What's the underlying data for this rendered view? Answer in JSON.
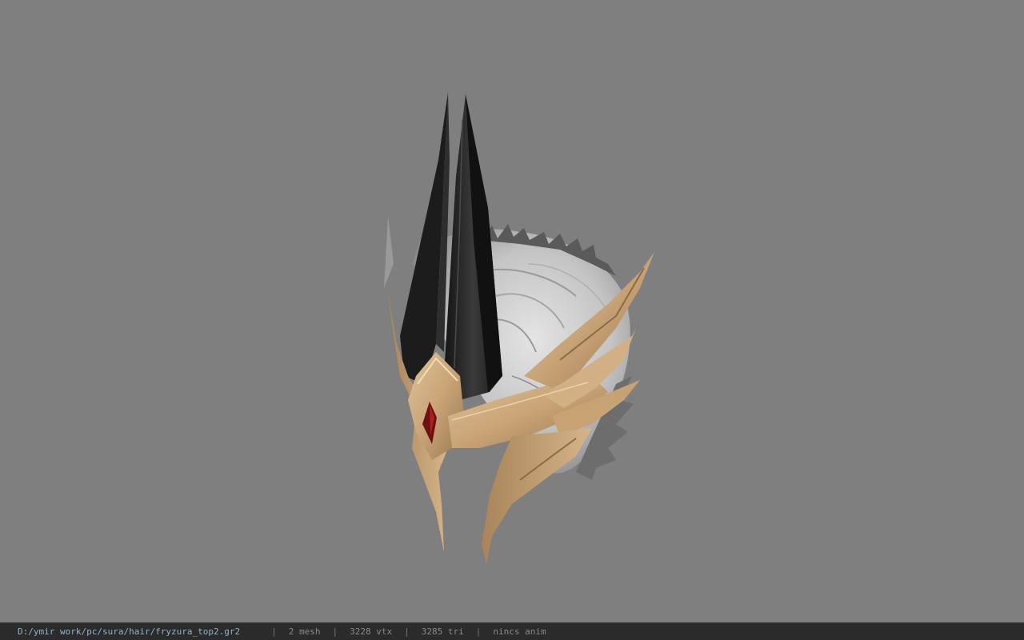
{
  "viewport": {
    "background_color": "#7f7f7f",
    "model_icon": "helmet-model"
  },
  "status_bar": {
    "file_path": "D:/ymir work/pc/sura/hair/fryzura_top2.gr2",
    "separator": "|",
    "mesh": "2 mesh",
    "vertices": "3228 vtx",
    "triangles": "3285 tri",
    "animation": "nincs anim",
    "path_color": "#8fb4cc",
    "background_color": "#2b2b2b"
  }
}
